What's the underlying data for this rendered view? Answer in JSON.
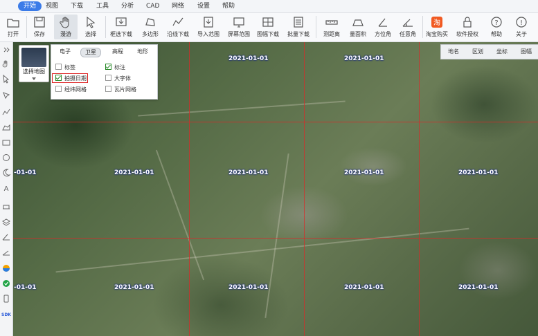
{
  "menubar": {
    "items": [
      {
        "label": "开始",
        "active": true
      },
      {
        "label": "视图"
      },
      {
        "label": "下载"
      },
      {
        "label": "工具"
      },
      {
        "label": "分析"
      },
      {
        "label": "CAD"
      },
      {
        "label": "网络"
      },
      {
        "label": "设置"
      },
      {
        "label": "帮助"
      }
    ]
  },
  "toolbar": {
    "open_label": "打开",
    "save_label": "保存",
    "pan_label": "漫游",
    "select_label": "选择",
    "rect_download_label": "框选下载",
    "polygon_label": "多边形",
    "line_download_label": "沿线下载",
    "import_range_label": "导入范围",
    "screen_range_label": "屏幕范围",
    "sheet_download_label": "图幅下载",
    "batch_download_label": "批量下载",
    "measure_distance_label": "测距离",
    "measure_area_label": "量面积",
    "azimuth_label": "方位角",
    "angle_label": "任意角",
    "taobao_label": "淘宝购买",
    "license_label": "软件授权",
    "help_label": "帮助",
    "about_label": "关于"
  },
  "map_switch": {
    "label": "选择地图"
  },
  "layer_panel": {
    "tabs": [
      {
        "label": "电子"
      },
      {
        "label": "卫星",
        "active": true
      },
      {
        "label": "高程"
      },
      {
        "label": "地形"
      }
    ],
    "options": [
      {
        "label": "标签",
        "checked": false
      },
      {
        "label": "标注",
        "checked": true
      },
      {
        "label": "拍摄日期",
        "checked": true
      },
      {
        "label": "大字体",
        "checked": false
      },
      {
        "label": "经纬网格",
        "checked": false
      },
      {
        "label": "瓦片网格",
        "checked": false
      }
    ]
  },
  "right_tabs": {
    "place": "地名",
    "region": "区划",
    "coord": "坐标",
    "sheet": "图幅"
  },
  "map": {
    "date_label": "2021-01-01",
    "partial_date_label": "-01-01",
    "grid_color": "#dc2828"
  },
  "leftbar": {
    "sdk_label": "SDK"
  }
}
